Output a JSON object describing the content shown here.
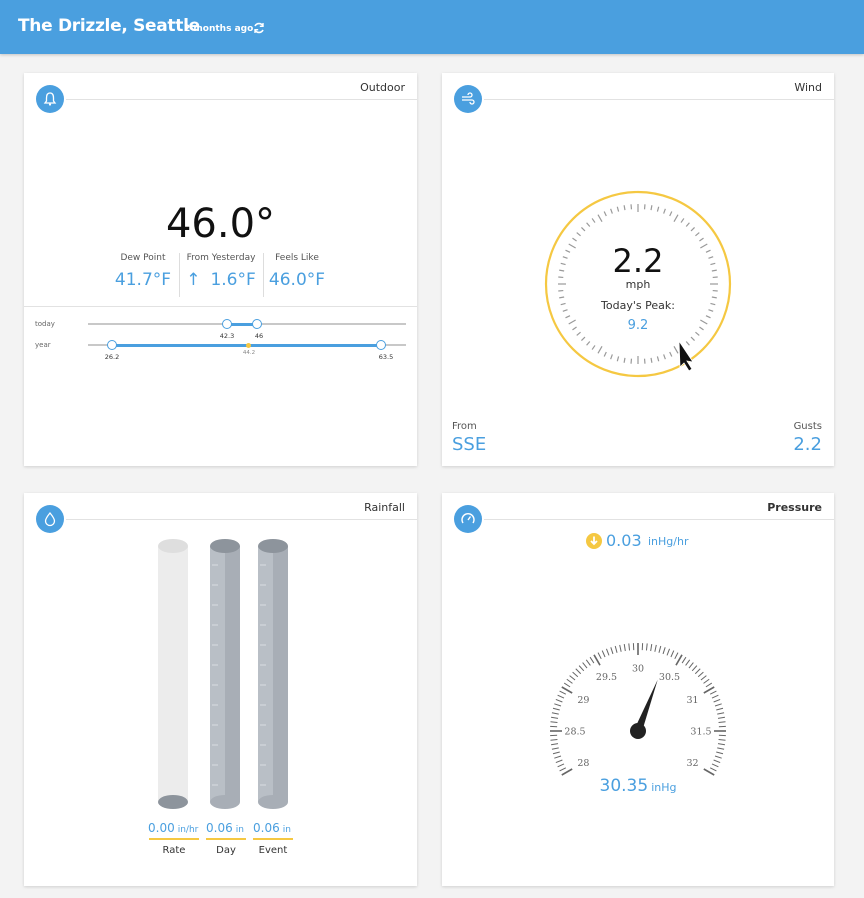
{
  "header": {
    "title": "The Drizzle, Seattle",
    "updated": "2 months ago",
    "refresh_icon": "refresh-icon"
  },
  "colors": {
    "accent": "#4a9fdf",
    "highlight": "#f5c842",
    "header_bg": "#4a9fdf"
  },
  "outdoor": {
    "label": "Outdoor",
    "icon": "bell-icon",
    "temperature": "46.0°",
    "dew_point": {
      "label": "Dew Point",
      "value": "41.7°F"
    },
    "from_yesterday": {
      "label": "From Yesterday",
      "value": "1.6°F"
    },
    "feels_like": {
      "label": "Feels Like",
      "value": "46.0°F"
    },
    "today": {
      "label": "today",
      "low": "42.3",
      "high": "46"
    },
    "year": {
      "label": "year",
      "low": "26.2",
      "mid": "44.2",
      "high": "63.5"
    }
  },
  "wind": {
    "label": "Wind",
    "icon": "wind-icon",
    "speed": "2.2",
    "unit": "mph",
    "peak_label": "Today's Peak:",
    "peak_value": "9.2",
    "from_label": "From",
    "from_value": "SSE",
    "gusts_label": "Gusts",
    "gusts_value": "2.2"
  },
  "rainfall": {
    "label": "Rainfall",
    "icon": "drop-icon",
    "rate": {
      "value": "0.00",
      "unit": "in/hr",
      "label": "Rate"
    },
    "day": {
      "value": "0.06",
      "unit": "in",
      "label": "Day"
    },
    "event": {
      "value": "0.06",
      "unit": "in",
      "label": "Event"
    }
  },
  "pressure": {
    "label": "Pressure",
    "icon": "gauge-icon",
    "rate_value": "0.03",
    "rate_unit": "inHg/hr",
    "rate_icon": "arrow-down-icon",
    "value": "30.35",
    "unit": "inHg",
    "dial_labels": [
      "28",
      "28.5",
      "29",
      "29.5",
      "30",
      "30.5",
      "31",
      "31.5",
      "32"
    ]
  }
}
